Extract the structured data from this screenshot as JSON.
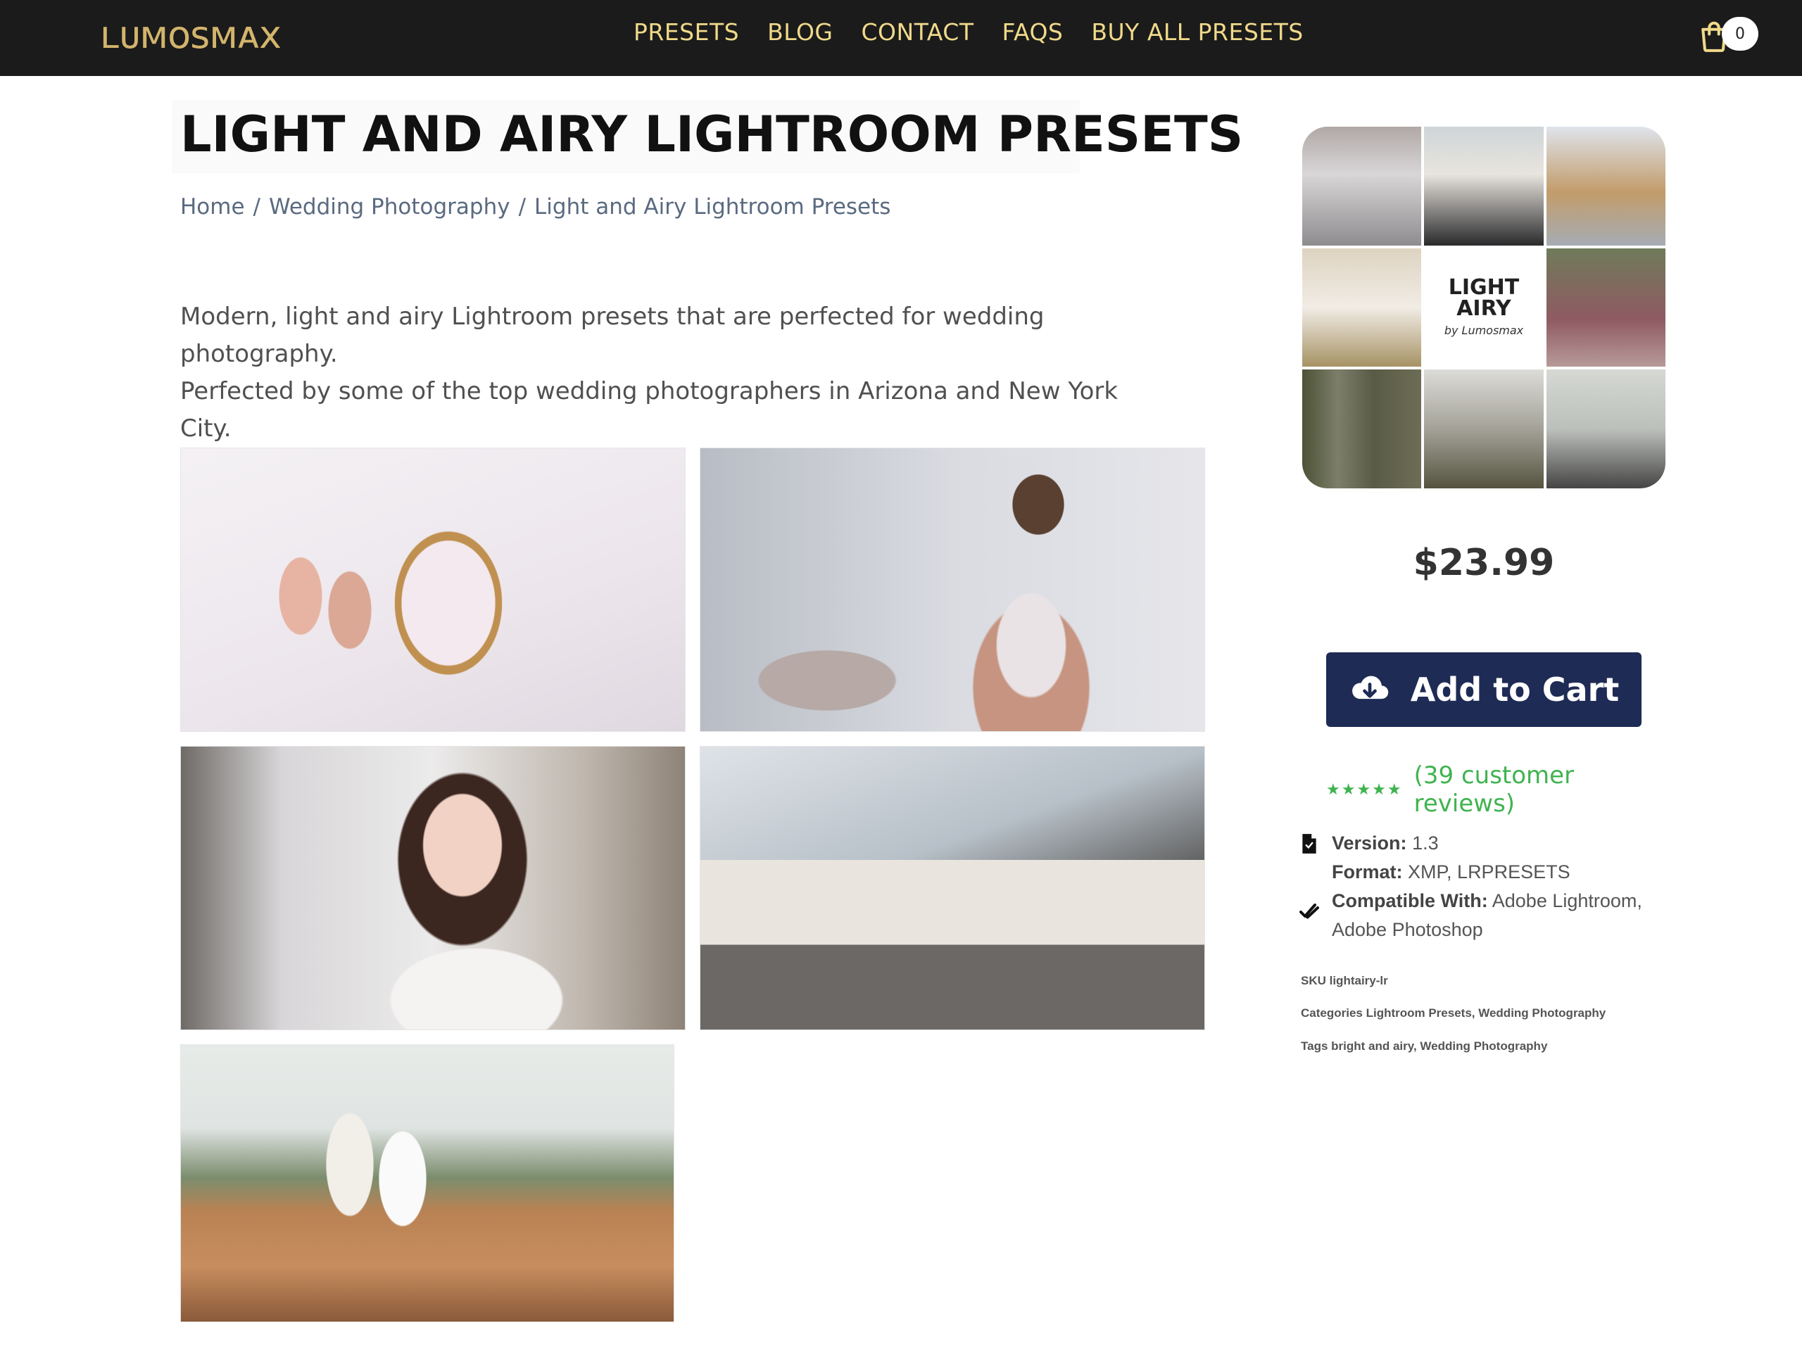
{
  "header": {
    "logo": "LUMOSMAX",
    "nav": [
      "PRESETS",
      "BLOG",
      "CONTACT",
      "FAQS",
      "BUY ALL PRESETS"
    ],
    "cart_count": "0",
    "cart_icon": "cart-icon",
    "background": "#1b1b1b",
    "accent": "#f0d98a"
  },
  "page": {
    "title": "LIGHT AND AIRY LIGHTROOM PRESETS",
    "breadcrumb": [
      "Home",
      "Wedding Photography",
      "Light and Airy Lightroom Presets"
    ],
    "description_line1": "Modern, light and airy Lightroom presets that are perfected for wedding photography.",
    "description_line2": "Perfected by some of the top wedding photographers in Arizona and New York City."
  },
  "product": {
    "thumb_title_line1": "LIGHT",
    "thumb_title_line2": "AIRY",
    "thumb_subtitle": "by Lumosmax",
    "price": "$23.99",
    "add_to_cart_label": "Add to Cart",
    "button_color": "#1e2b55",
    "stars": "★★★★★",
    "reviews_label": "(39 customer reviews)",
    "rating_color": "#3fb34f",
    "version_label": "Version:",
    "version_value": "1.3",
    "format_label": "Format:",
    "format_value": "XMP, LRPRESETS",
    "compat_label": "Compatible With:",
    "compat_value_line1": "Adobe Lightroom,",
    "compat_value_line2": "Adobe Photoshop",
    "sku": "SKU lightairy-lr",
    "categories": "Categories Lightroom Presets, Wedding Photography",
    "tags": "Tags bright and airy, Wedding Photography"
  }
}
